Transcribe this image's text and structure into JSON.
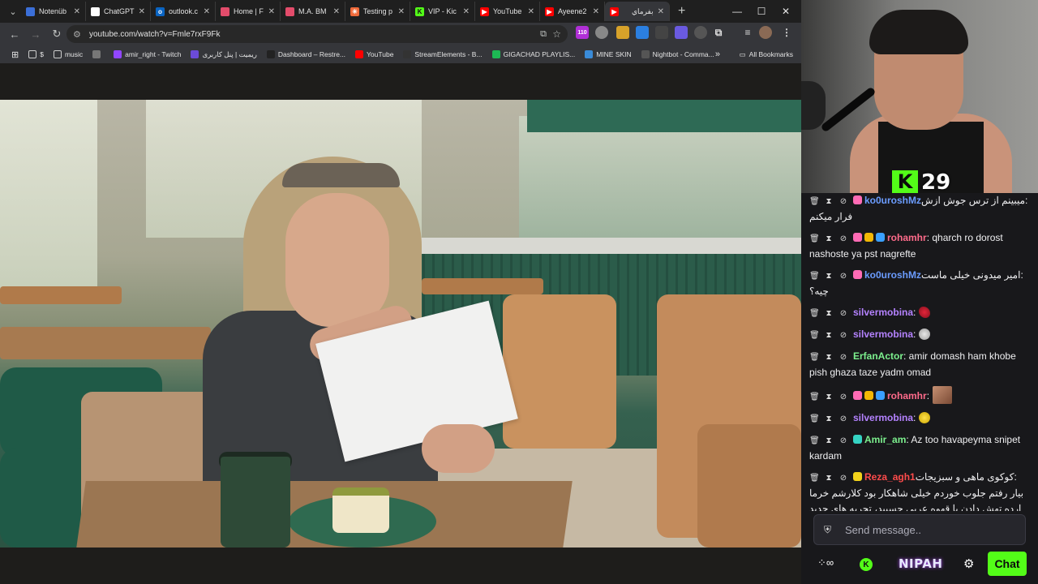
{
  "tabs": [
    {
      "title": "Notenüb",
      "icon": "book-icon",
      "color": "#3b6fd8",
      "glyph": ""
    },
    {
      "title": "ChatGPT",
      "icon": "openai-icon",
      "color": "#ffffff",
      "glyph": ""
    },
    {
      "title": "outlook.c",
      "icon": "outlook-icon",
      "color": "#0a64c2",
      "glyph": "o"
    },
    {
      "title": "Home | F",
      "icon": "home-icon",
      "color": "#e34c6b",
      "glyph": ""
    },
    {
      "title": "M.A. BM",
      "icon": "ma-icon",
      "color": "#e34c6b",
      "glyph": ""
    },
    {
      "title": "Testing p",
      "icon": "spark-icon",
      "color": "#f06a3a",
      "glyph": "✳"
    },
    {
      "title": "VIP - Kic",
      "icon": "kick-icon",
      "color": "#53fc18",
      "glyph": "K"
    },
    {
      "title": "YouTube",
      "icon": "youtube-icon",
      "color": "#ff0000",
      "glyph": "▶"
    },
    {
      "title": "Ayeene2",
      "icon": "youtube-icon",
      "color": "#ff0000",
      "glyph": "▶"
    },
    {
      "title": "بفرماي",
      "icon": "youtube-icon",
      "color": "#ff0000",
      "glyph": "▶"
    }
  ],
  "browser": {
    "url": "youtube.com/watch?v=Fmle7rxF9Fk",
    "extension_badge": "110"
  },
  "bookmarks": [
    {
      "label": "$",
      "icon": "folder-icon",
      "color": "#555"
    },
    {
      "label": "music",
      "icon": "folder-icon",
      "color": "#555"
    },
    {
      "label": "",
      "icon": "globe-icon",
      "color": "#777"
    },
    {
      "label": "amir_right - Twitch",
      "icon": "twitch-icon",
      "color": "#9146ff"
    },
    {
      "label": "ریمیت | پنل کاربری",
      "icon": "remit-icon",
      "color": "#6b4bd8"
    },
    {
      "label": "Dashboard – Restre...",
      "icon": "restream-icon",
      "color": "#222"
    },
    {
      "label": "YouTube",
      "icon": "youtube-icon",
      "color": "#ff0000"
    },
    {
      "label": "StreamElements - B...",
      "icon": "streamelements-icon",
      "color": "#333"
    },
    {
      "label": "GIGACHAD PLAYLIS...",
      "icon": "spotify-icon",
      "color": "#1db954"
    },
    {
      "label": "MINE SKIN",
      "icon": "mineskin-icon",
      "color": "#3a8bd8"
    },
    {
      "label": "Nightbot - Comma...",
      "icon": "nightbot-icon",
      "color": "#555"
    }
  ],
  "all_bookmarks": "All Bookmarks",
  "stream": {
    "viewer_count": "29",
    "kick_logo": "K"
  },
  "chat": [
    {
      "user": "ko0uroshMz",
      "color": "#6b9cff",
      "badges": [
        "sub"
      ],
      "text": ":میبینم از ترس جوش ازش فرار میکنم",
      "rtl": true
    },
    {
      "user": "rohamhr",
      "color": "#ff6b8b",
      "badges": [
        "sub",
        "gold",
        "blue"
      ],
      "text": ": qharch ro dorost nashoste ya pst nagrefte",
      "rtl": false
    },
    {
      "user": "ko0uroshMz",
      "color": "#6b9cff",
      "badges": [
        "sub"
      ],
      "text": ":امیر میدونی خیلی ماست چیه؟",
      "rtl": true
    },
    {
      "user": "silvermobina",
      "color": "#b482ff",
      "badges": [],
      "text": ":",
      "emote": "red-lips-emote",
      "rtl": false
    },
    {
      "user": "silvermobina",
      "color": "#b482ff",
      "badges": [],
      "text": ":",
      "emote": "hand-emote",
      "rtl": false
    },
    {
      "user": "ErfanActor",
      "color": "#7cf08e",
      "badges": [],
      "text": ": amir domash ham khobe pish ghaza taze yadm omad",
      "rtl": false
    },
    {
      "user": "rohamhr",
      "color": "#ff6b8b",
      "badges": [
        "sub",
        "gold",
        "blue"
      ],
      "text": ":",
      "emote": "face-emote",
      "rtl": false
    },
    {
      "user": "silvermobina",
      "color": "#b482ff",
      "badges": [],
      "text": ":",
      "emote": "bird-emote",
      "rtl": false
    },
    {
      "user": "Amir_am",
      "color": "#7cf08e",
      "badges": [
        "teal"
      ],
      "text": ": Az too havapeyma snipet kardam",
      "rtl": false
    },
    {
      "user": "Reza_agh1",
      "color": "#ff4b4b",
      "badges": [
        "yellow"
      ],
      "text": ":کوکوی ماهی و سبزیجات بیار رفتم جلوب خوردم خیلی شاهکار بود کلارشم خرما ارده تهش دادن با قهوه عربی چسبید، تجربه های جدید خیلی باحاله",
      "rtl": true
    }
  ],
  "chat_input": {
    "placeholder": "Send message.."
  },
  "footer": {
    "brand": "NIPAH",
    "chat_button": "Chat"
  }
}
